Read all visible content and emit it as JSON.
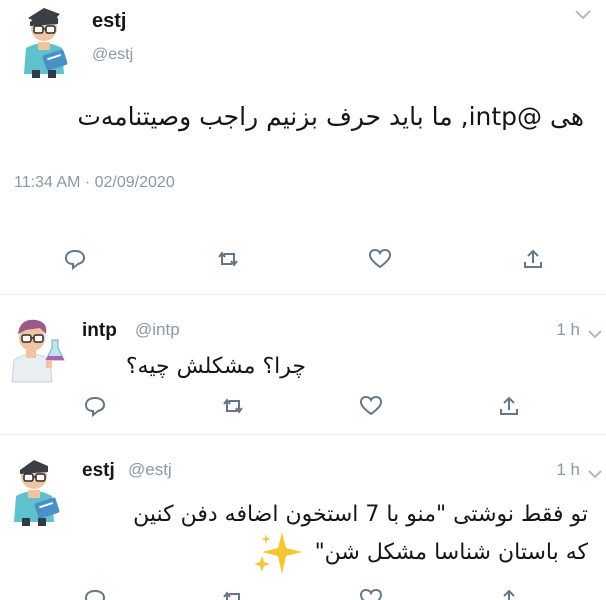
{
  "main_tweet": {
    "display_name": "estj",
    "handle": "@estj",
    "text": "هی @intp, ما باید حرف بزنیم راجب وصیتنامه‌ت",
    "timestamp": "11:34 AM · 02/09/2020",
    "icons": [
      "reply-icon",
      "retweet-icon",
      "like-icon",
      "share-icon",
      "chevron-down-icon"
    ]
  },
  "replies": [
    {
      "display_name": "intp",
      "handle": "@intp",
      "time": "1 h",
      "text_lines": [
        "چرا؟ مشکلش چیه؟"
      ]
    },
    {
      "display_name": "estj",
      "handle": "@estj",
      "time": "1 h",
      "text_lines": [
        "تو فقط نوشتی \"منو با 7 استخون اضافه دفن کنین",
        "که باستان شناسا مشکل شن\""
      ]
    }
  ],
  "colors": {
    "secondary_text": "#8899a6",
    "primary_text": "#14171a",
    "divider": "#e6ecf0",
    "sparkle": "#f7c531"
  }
}
